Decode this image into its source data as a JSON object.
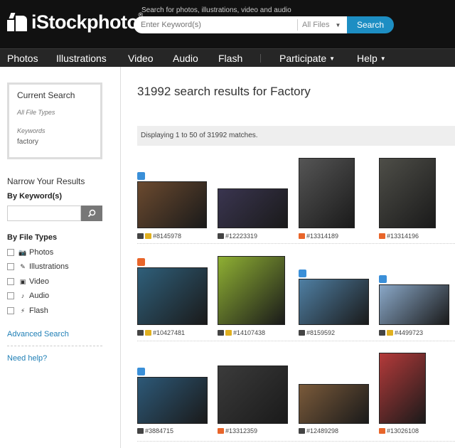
{
  "brand": {
    "name": "iStockphoto",
    "tm": "®"
  },
  "search": {
    "hint": "Search for photos, illustrations, video and audio",
    "placeholder": "Enter Keyword(s)",
    "file_filter": "All Files",
    "button": "Search"
  },
  "nav": {
    "items": [
      "Photos",
      "Illustrations",
      "Video",
      "Audio",
      "Flash"
    ],
    "participate": "Participate",
    "help": "Help"
  },
  "sidebar": {
    "current_search_title": "Current Search",
    "file_types_value": "All File Types",
    "keywords_label": "Keywords",
    "keywords_value": "factory",
    "narrow_title": "Narrow Your Results",
    "by_keyword": "By Keyword(s)",
    "by_file_types": "By File Types",
    "file_types": [
      {
        "label": "Photos",
        "icon": "camera-icon"
      },
      {
        "label": "Illustrations",
        "icon": "pen-icon"
      },
      {
        "label": "Video",
        "icon": "video-icon"
      },
      {
        "label": "Audio",
        "icon": "note-icon"
      },
      {
        "label": "Flash",
        "icon": "flash-icon"
      }
    ],
    "advanced_search": "Advanced Search",
    "need_help": "Need help?"
  },
  "results": {
    "title": "31992 search results for Factory",
    "displaying": "Displaying 1 to 50 of 31992 matches.",
    "items": [
      {
        "id": "#8145978",
        "color": "#6b4a2f"
      },
      {
        "id": "#12223319",
        "color": "#3a3550"
      },
      {
        "id": "#13314189",
        "color": "#555555"
      },
      {
        "id": "#13314196",
        "color": "#4e4e48"
      },
      {
        "id": "#10427481",
        "color": "#2f5f7a"
      },
      {
        "id": "#14107438",
        "color": "#8fb033"
      },
      {
        "id": "#8159592",
        "color": "#4f7fa3"
      },
      {
        "id": "#4499723",
        "color": "#8aa8c8"
      },
      {
        "id": "#3884715",
        "color": "#2d5978"
      },
      {
        "id": "#13312359",
        "color": "#3b3b3b"
      },
      {
        "id": "#12489298",
        "color": "#7a5a3a"
      },
      {
        "id": "#13026108",
        "color": "#b43a3a"
      }
    ]
  }
}
